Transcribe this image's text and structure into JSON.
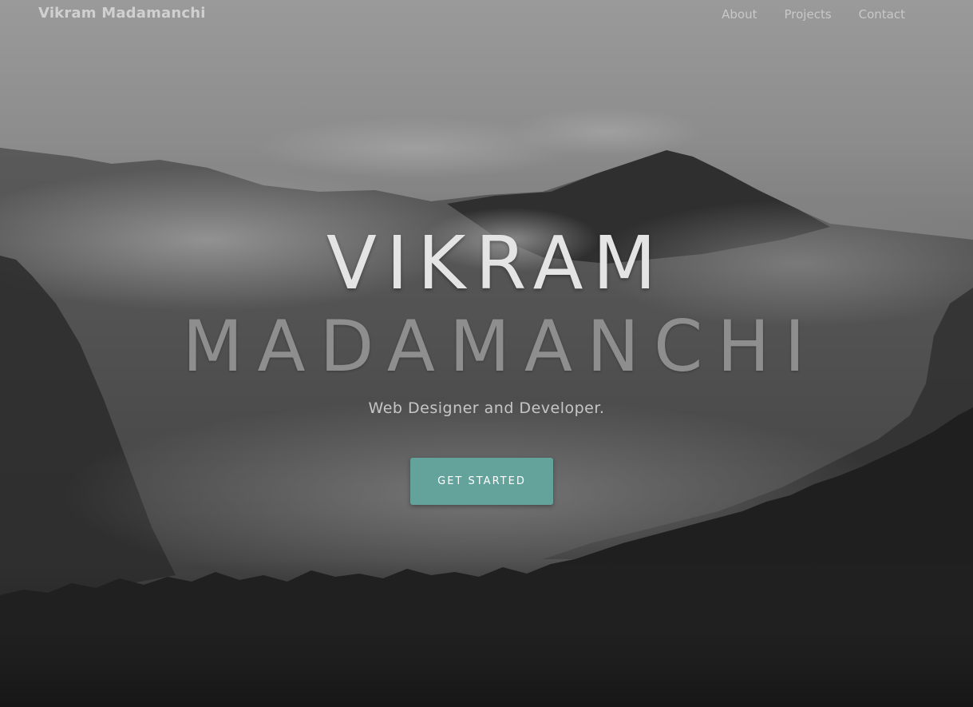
{
  "nav": {
    "brand": "Vikram Madamanchi",
    "links": [
      {
        "label": "About"
      },
      {
        "label": "Projects"
      },
      {
        "label": "Contact"
      }
    ]
  },
  "hero": {
    "title_line1": "VIKRAM",
    "title_line2": "MADAMANCHI",
    "subtitle": "Web Designer and Developer.",
    "cta_label": "GET STARTED"
  },
  "colors": {
    "accent": "#64a39c",
    "nav_text": "#c8c8c8",
    "title_light": "#e4e4e4",
    "title_dim": "#8e8e8e"
  }
}
